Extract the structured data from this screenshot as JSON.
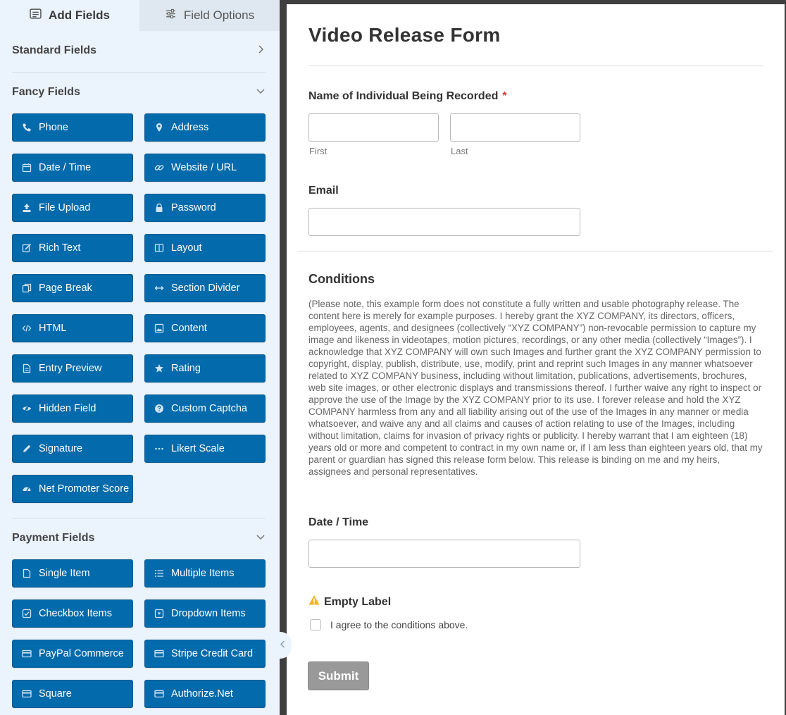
{
  "tabs": {
    "add_fields": "Add Fields",
    "field_options": "Field Options",
    "add_fields_icon": "list-icon",
    "field_options_icon": "sliders-icon"
  },
  "sections": {
    "standard": {
      "title": "Standard Fields",
      "state": "collapsed"
    },
    "fancy": {
      "title": "Fancy Fields",
      "state": "expanded",
      "buttons": [
        {
          "label": "Phone",
          "icon": "phone-icon"
        },
        {
          "label": "Address",
          "icon": "map-pin-icon"
        },
        {
          "label": "Date / Time",
          "icon": "calendar-icon"
        },
        {
          "label": "Website / URL",
          "icon": "link-icon"
        },
        {
          "label": "File Upload",
          "icon": "upload-icon"
        },
        {
          "label": "Password",
          "icon": "lock-icon"
        },
        {
          "label": "Rich Text",
          "icon": "edit-icon"
        },
        {
          "label": "Layout",
          "icon": "columns-icon"
        },
        {
          "label": "Page Break",
          "icon": "copy-icon"
        },
        {
          "label": "Section Divider",
          "icon": "arrows-h-icon"
        },
        {
          "label": "HTML",
          "icon": "code-icon"
        },
        {
          "label": "Content",
          "icon": "image-icon"
        },
        {
          "label": "Entry Preview",
          "icon": "file-text-icon"
        },
        {
          "label": "Rating",
          "icon": "star-icon"
        },
        {
          "label": "Hidden Field",
          "icon": "eye-slash-icon"
        },
        {
          "label": "Custom Captcha",
          "icon": "question-circle-icon"
        },
        {
          "label": "Signature",
          "icon": "pencil-icon"
        },
        {
          "label": "Likert Scale",
          "icon": "ellipsis-icon"
        },
        {
          "label": "Net Promoter Score",
          "icon": "tachometer-icon"
        }
      ]
    },
    "payment": {
      "title": "Payment Fields",
      "state": "expanded",
      "buttons": [
        {
          "label": "Single Item",
          "icon": "file-icon"
        },
        {
          "label": "Multiple Items",
          "icon": "list-ul-icon"
        },
        {
          "label": "Checkbox Items",
          "icon": "check-square-icon"
        },
        {
          "label": "Dropdown Items",
          "icon": "caret-square-icon"
        },
        {
          "label": "PayPal Commerce",
          "icon": "credit-card-icon"
        },
        {
          "label": "Stripe Credit Card",
          "icon": "credit-card-icon"
        },
        {
          "label": "Square",
          "icon": "credit-card-icon"
        },
        {
          "label": "Authorize.Net",
          "icon": "credit-card-icon"
        }
      ]
    }
  },
  "form": {
    "title": "Video Release Form",
    "name_field": {
      "label": "Name of Individual Being Recorded",
      "required_mark": "*",
      "first_sublabel": "First",
      "last_sublabel": "Last"
    },
    "email_field": {
      "label": "Email"
    },
    "conditions": {
      "title": "Conditions",
      "text": "(Please note, this example form does not constitute a fully written and usable photography release. The content here is merely for example purposes. I hereby grant the XYZ COMPANY, its directors, officers, employees, agents, and designees (collectively “XYZ COMPANY”) non-revocable permission to capture my image and likeness in videotapes, motion pictures, recordings, or any other media (collectively “Images”). I acknowledge that XYZ COMPANY will own such Images and further grant the XYZ COMPANY permission to copyright, display, publish, distribute, use, modify, print and reprint such Images in any manner whatsoever related to XYZ COMPANY business, including without limitation, publications, advertisements, brochures, web site images, or other electronic displays and transmissions thereof. I further waive any right to inspect or approve the use of the Image by the XYZ COMPANY prior to its use. I forever release and hold the XYZ COMPANY harmless from any and all liability arising out of the use of the Images in any manner or media whatsoever, and waive any and all claims and causes of action relating to use of the Images, including without limitation, claims for invasion of privacy rights or publicity. I hereby warrant that I am eighteen (18) years old or more and competent to contract in my own name or, if I am less than eighteen years old, that my parent or guardian has signed this release form below. This release is binding on me and my heirs, assignees and personal representatives."
    },
    "date_field": {
      "label": "Date / Time"
    },
    "checkbox_field": {
      "label": "Empty Label",
      "warning_icon": "warning-icon",
      "warning_color": "#f0b429",
      "option": "I agree to the conditions above."
    },
    "submit_label": "Submit"
  },
  "colors": {
    "field_button": "#036aab",
    "panel_bg": "#ebf3fc",
    "submit_bg": "#999999",
    "required": "#d63638"
  }
}
